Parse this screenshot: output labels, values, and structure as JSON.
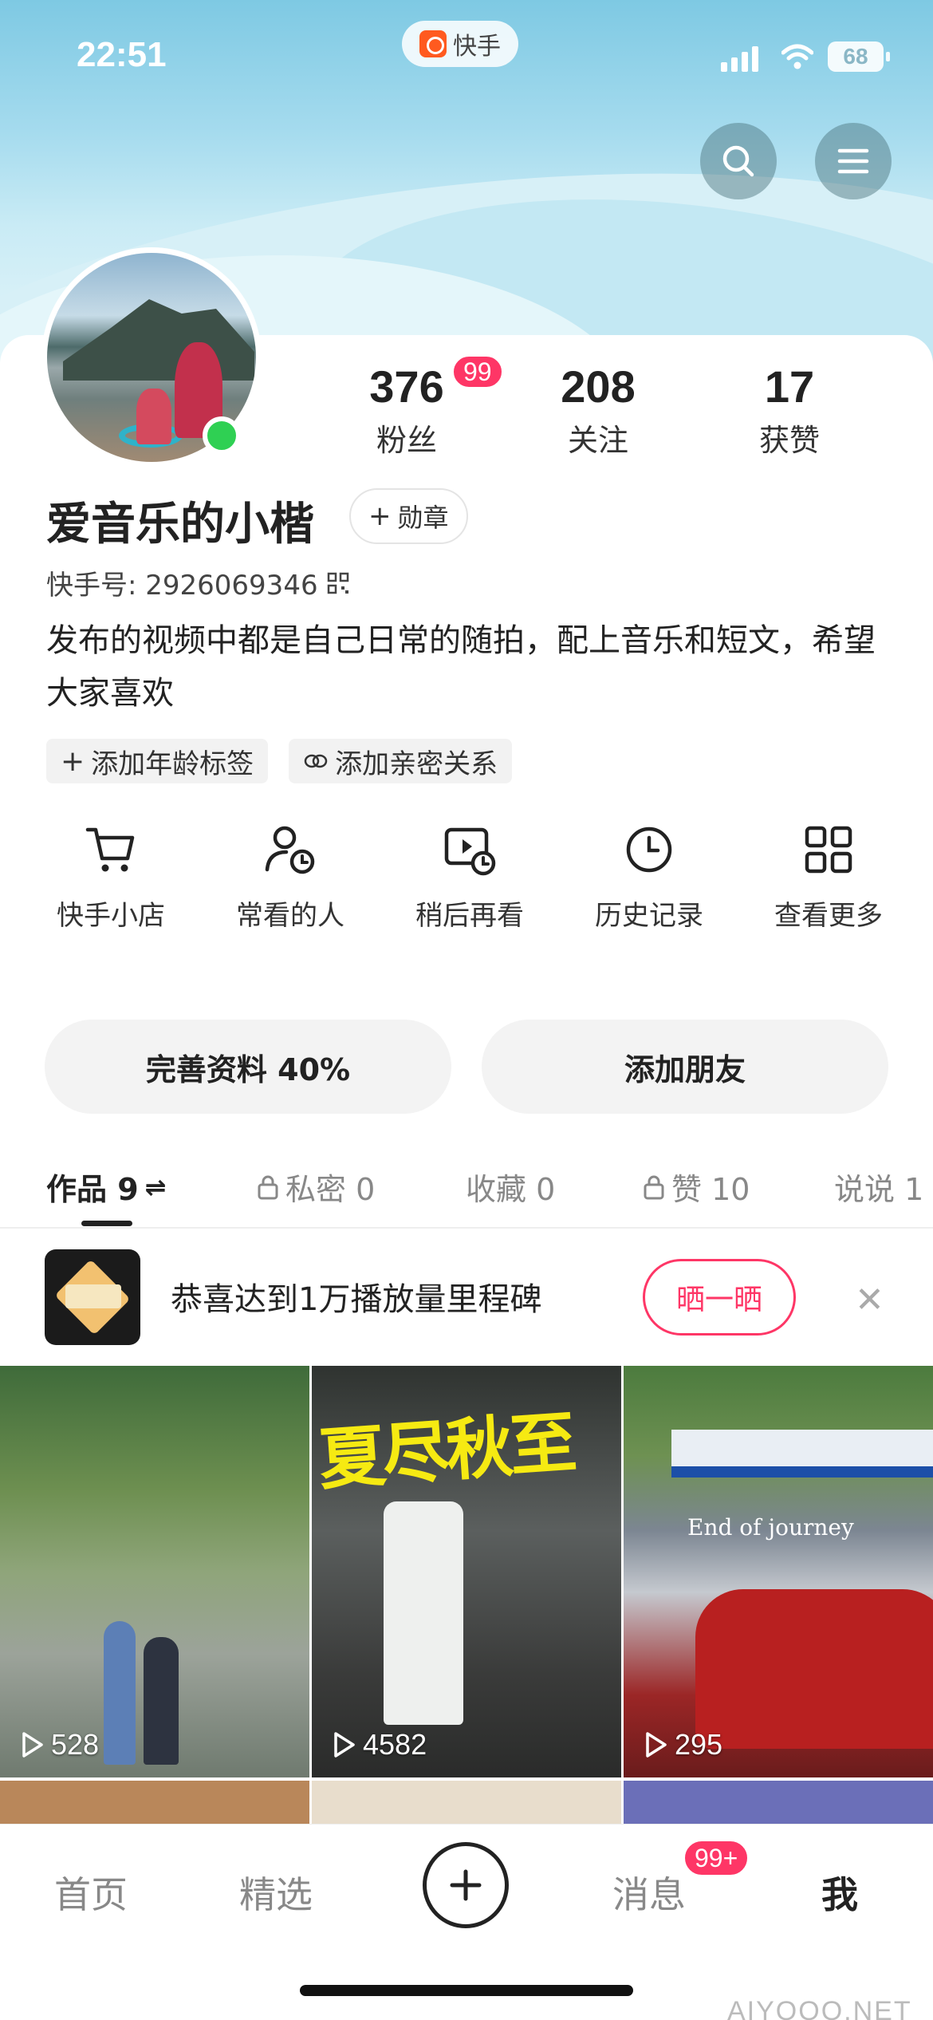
{
  "status_bar": {
    "time": "22:51",
    "app_name": "快手",
    "battery": "68"
  },
  "profile": {
    "nickname": "爱音乐的小楷",
    "medal_label": "勋章",
    "ks_id": "快手号: 2926069346",
    "bio": "发布的视频中都是自己日常的随拍，配上音乐和短文，希望大家喜欢",
    "online": true
  },
  "stats": [
    {
      "num": "376",
      "label": "粉丝",
      "badge": "99"
    },
    {
      "num": "208",
      "label": "关注"
    },
    {
      "num": "17",
      "label": "获赞"
    }
  ],
  "tags": [
    {
      "label": "添加年龄标签",
      "icon": "plus-icon"
    },
    {
      "label": "添加亲密关系",
      "icon": "link-icon"
    }
  ],
  "shortcuts": [
    {
      "label": "快手小店",
      "icon": "cart-icon"
    },
    {
      "label": "常看的人",
      "icon": "person-clock-icon"
    },
    {
      "label": "稍后再看",
      "icon": "video-clock-icon"
    },
    {
      "label": "历史记录",
      "icon": "clock-icon"
    },
    {
      "label": "查看更多",
      "icon": "grid-icon"
    }
  ],
  "buttons": {
    "complete_profile": "完善资料 40%",
    "add_friend": "添加朋友"
  },
  "tabs": [
    {
      "label": "作品 9",
      "active": true
    },
    {
      "label": "私密 0",
      "locked": true
    },
    {
      "label": "收藏 0"
    },
    {
      "label": "赞 10",
      "locked": true
    },
    {
      "label": "说说 1"
    }
  ],
  "milestone": {
    "text": "恭喜达到1万播放量里程碑",
    "button": "晒一晒"
  },
  "videos": [
    {
      "plays": "528"
    },
    {
      "plays": "4582",
      "title": "夏尽秋至"
    },
    {
      "plays": "295",
      "caption": "End of journey"
    }
  ],
  "bottom_nav": [
    {
      "label": "首页"
    },
    {
      "label": "精选"
    },
    {
      "label": "消息",
      "badge": "99+"
    },
    {
      "label": "我",
      "active": true
    }
  ],
  "watermark": "AIYOOO.NET",
  "colors": {
    "accent": "#fe3666",
    "online": "#2fd053",
    "sky": "#a5dbee"
  }
}
